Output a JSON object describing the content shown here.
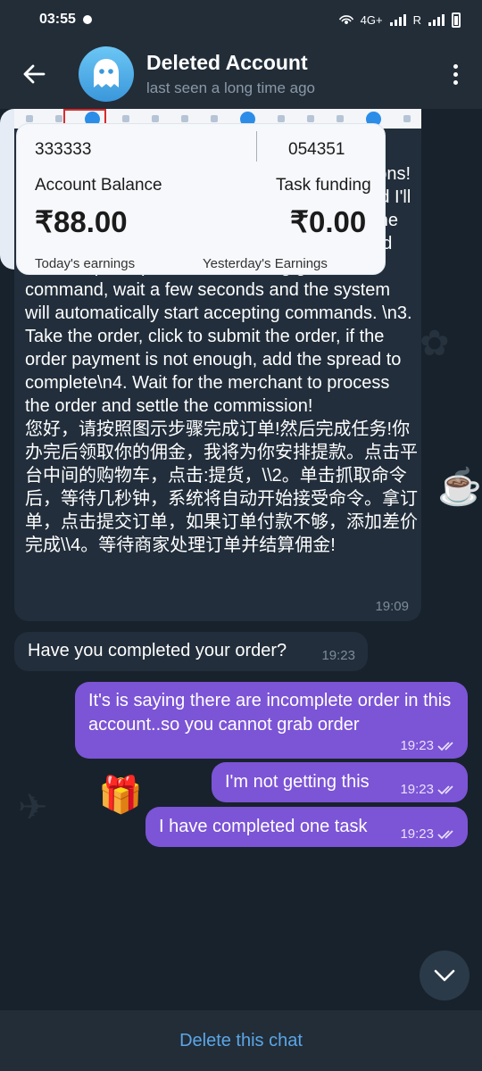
{
  "status_bar": {
    "time": "03:55",
    "network": "4G+",
    "roaming": "R"
  },
  "header": {
    "title": "Deleted Account",
    "subtitle": "last seen a long time ago"
  },
  "messages": [
    {
      "direction": "in",
      "text": "Hello, please follow the illustrated steps to complete the order! Then complete the missions! Claim your commission when you're done and I'll arrange a withdrawal for you!\\n\\n1. Click on the shopping cart in the middle of the platform and click on: pick up,\\n2. After clicking grab command, wait a few seconds and the system will automatically start accepting commands. \\n3. Take the order, click to submit the order, if the order payment is not enough, add the spread to complete\\n4. Wait for the merchant to process the order and settle the commission!\n您好，请按照图示步骤完成订单!然后完成任务!你办完后领取你的佣金，我将为你安排提款。点击平台中间的购物车，点击:提货，\\\\2。单击抓取命令后，等待几秒钟，系统将自动开始接受命令。拿订单，点击提交订单，如果订单付款不够，添加差价完成\\\\4。等待商家处理订单并结算佣金!",
      "time": "19:09"
    },
    {
      "direction": "in",
      "text": "Have you completed your order?",
      "time": "19:23"
    },
    {
      "direction": "out",
      "text": "It's is saying there are incomplete order in this account..so you cannot grab order",
      "time": "19:23"
    },
    {
      "direction": "out",
      "text": "I'm not getting this",
      "time": "19:23"
    },
    {
      "direction": "out",
      "text": "I have completed one task",
      "time": "19:23"
    }
  ],
  "image_card": {
    "id_left": "333333",
    "id_right": "054351",
    "label_left": "Account Balance",
    "label_right": "Task funding",
    "amount_left": "₹88.00",
    "amount_right": "₹0.00",
    "sub_left": "Today's earnings",
    "sub_right": "Yesterday's Earnings"
  },
  "bottom": {
    "delete_label": "Delete this chat"
  },
  "colors": {
    "header_bg": "#222d38",
    "chat_bg": "#18222c",
    "incoming_bubble": "#222e3b",
    "outgoing_bubble": "#7c54d6",
    "accent": "#5ca6e6"
  }
}
